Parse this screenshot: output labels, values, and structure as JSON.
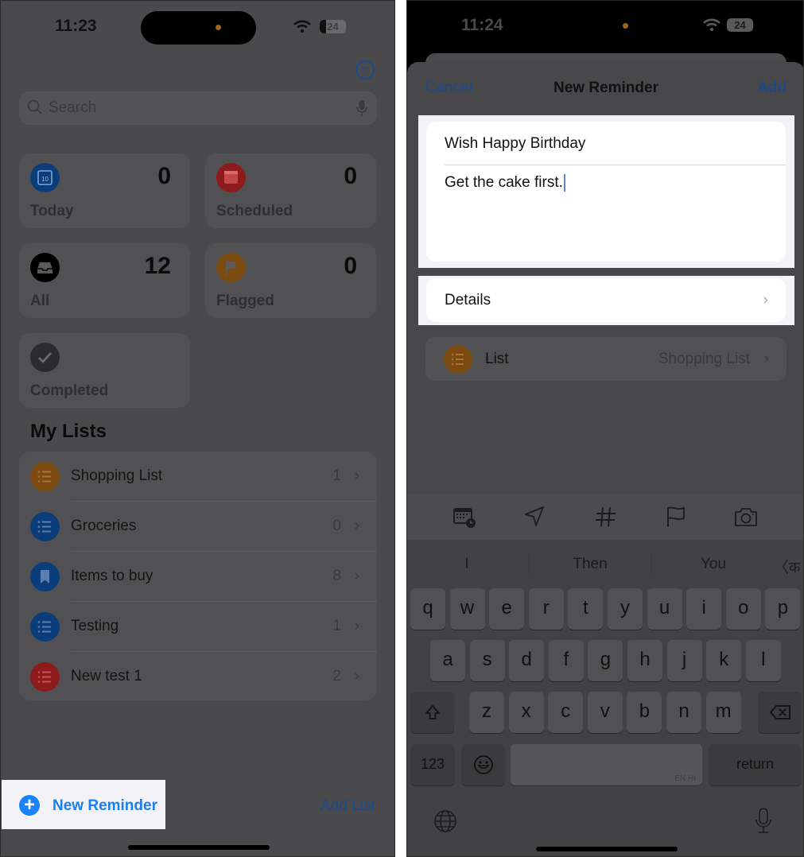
{
  "left_screen": {
    "status": {
      "time": "11:23",
      "battery": "24"
    },
    "search_placeholder": "Search",
    "smart_lists": [
      {
        "label": "Today",
        "count": "0",
        "icon": "calendar-today-icon",
        "color": "#0a3d7a"
      },
      {
        "label": "Scheduled",
        "count": "0",
        "icon": "calendar-scheduled-icon",
        "color": "#8e1b1b"
      },
      {
        "label": "All",
        "count": "12",
        "icon": "tray-icon",
        "color": "#000000"
      },
      {
        "label": "Flagged",
        "count": "0",
        "icon": "flag-icon",
        "color": "#7a4a10"
      },
      {
        "label": "Completed",
        "count": "",
        "icon": "checkmark-icon",
        "color": "#2b2b2e"
      }
    ],
    "my_lists_heading": "My Lists",
    "lists": [
      {
        "name": "Shopping List",
        "count": "1",
        "icon": "list-bullet-icon",
        "color": "#7a4a10"
      },
      {
        "name": "Groceries",
        "count": "0",
        "icon": "list-bullet-icon",
        "color": "#0a3d7a"
      },
      {
        "name": "Items to buy",
        "count": "8",
        "icon": "bookmark-icon",
        "color": "#0a3d7a"
      },
      {
        "name": "Testing",
        "count": "1",
        "icon": "list-bullet-icon",
        "color": "#0a3d7a"
      },
      {
        "name": "New test 1",
        "count": "2",
        "icon": "list-bullet-icon",
        "color": "#8e1b1b"
      }
    ],
    "new_reminder_label": "New Reminder",
    "add_list_label": "Add List",
    "accent": "#1a82fb"
  },
  "right_screen": {
    "status": {
      "time": "11:24",
      "battery": "24"
    },
    "nav": {
      "cancel": "Cancel",
      "title": "New Reminder",
      "add": "Add"
    },
    "title_value": "Wish Happy Birthday",
    "notes_value": "Get the cake first.",
    "details_label": "Details",
    "list_row": {
      "label": "List",
      "value": "Shopping List"
    },
    "toolbar_icons": [
      "calendar-clock-icon",
      "location-arrow-icon",
      "hashtag-icon",
      "flag-icon",
      "camera-icon"
    ],
    "suggestions": [
      "I",
      "Then",
      "You",
      "〈क"
    ],
    "keyboard": {
      "row1": [
        "q",
        "w",
        "e",
        "r",
        "t",
        "y",
        "u",
        "i",
        "o",
        "p"
      ],
      "row2": [
        "a",
        "s",
        "d",
        "f",
        "g",
        "h",
        "j",
        "k",
        "l"
      ],
      "row3": [
        "z",
        "x",
        "c",
        "v",
        "b",
        "n",
        "m"
      ],
      "numbers_key": "123",
      "return_key": "return",
      "space_hint": "EN HI"
    }
  }
}
